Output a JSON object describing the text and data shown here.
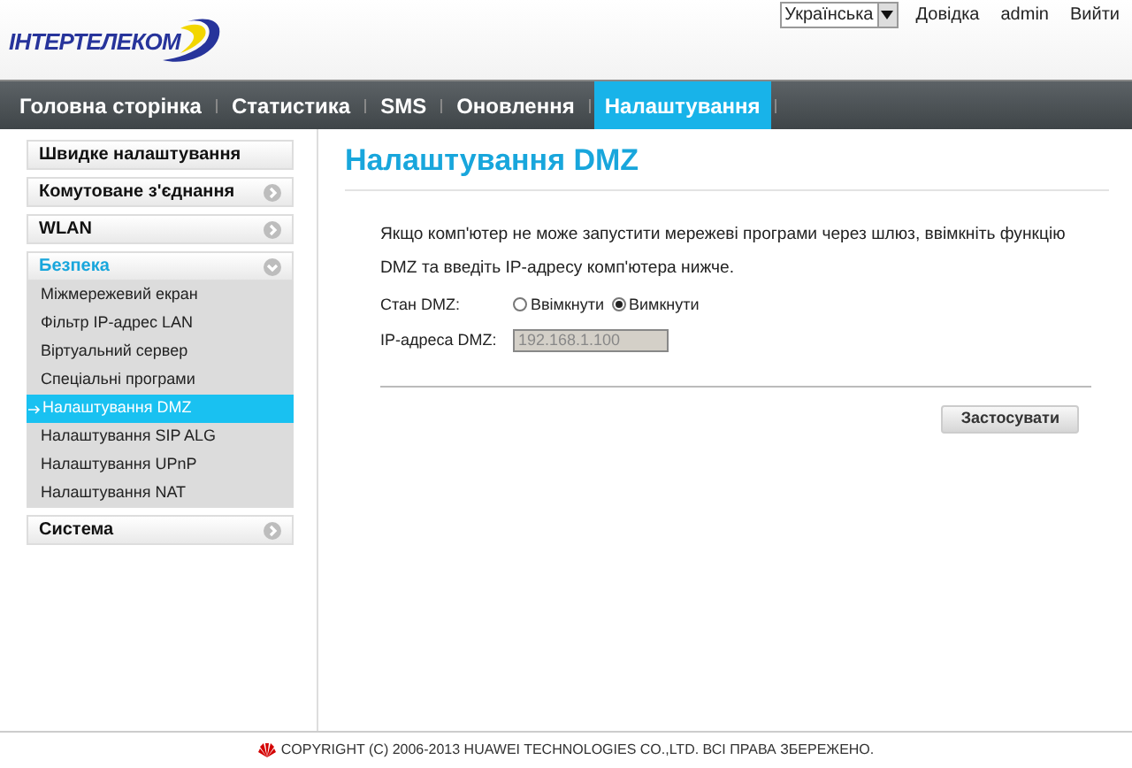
{
  "header": {
    "logo": "ІНТЕРТЕЛЕКОМ",
    "language": "Українська",
    "links": [
      "Довідка",
      "admin",
      "Вийти"
    ]
  },
  "nav": [
    {
      "label": "Головна сторінка",
      "selected": false
    },
    {
      "label": "Статистика",
      "selected": false
    },
    {
      "label": "SMS",
      "selected": false
    },
    {
      "label": "Оновлення",
      "selected": false
    },
    {
      "label": "Налаштування",
      "selected": true
    }
  ],
  "sidebar": [
    {
      "kind": "link",
      "label": "Швидке налаштування",
      "selected": false
    },
    {
      "kind": "group",
      "label": "Комутоване з'єднання",
      "selected": false,
      "expanded": false
    },
    {
      "kind": "group",
      "label": "WLAN",
      "selected": false,
      "expanded": false
    },
    {
      "kind": "group",
      "label": "Безпека",
      "selected": true,
      "expanded": true,
      "children": [
        {
          "label": "Міжмережевий екран",
          "selected": false
        },
        {
          "label": "Фільтр IP-адрес LAN",
          "selected": false
        },
        {
          "label": "Віртуальний сервер",
          "selected": false
        },
        {
          "label": "Спеціальні програми",
          "selected": false
        },
        {
          "label": "Налаштування DMZ",
          "selected": true
        },
        {
          "label": "Налаштування SIP ALG",
          "selected": false
        },
        {
          "label": "Налаштування UPnP",
          "selected": false
        },
        {
          "label": "Налаштування NAT",
          "selected": false
        }
      ]
    },
    {
      "kind": "group",
      "label": "Система",
      "selected": false,
      "expanded": false
    }
  ],
  "content": {
    "title": "Налаштування DMZ",
    "description": "Якщо комп'ютер не може запустити мережеві програми через шлюз, ввімкніть функцію DMZ та введіть IP-адресу комп'ютера нижче.",
    "status": {
      "label": "Стан DMZ:",
      "options": [
        {
          "label": "Ввімкнути",
          "selected": false
        },
        {
          "label": "Вимкнути",
          "selected": true
        }
      ]
    },
    "ip": {
      "label": "IP-адреса DMZ:",
      "value": "192.168.1.100",
      "disabled": true
    },
    "apply_button": "Застосувати"
  },
  "footer": "COPYRIGHT (C) 2006-2013 HUAWEI TECHNOLOGIES CO.,LTD. ВСІ ПРАВА ЗБЕРЕЖЕНО."
}
